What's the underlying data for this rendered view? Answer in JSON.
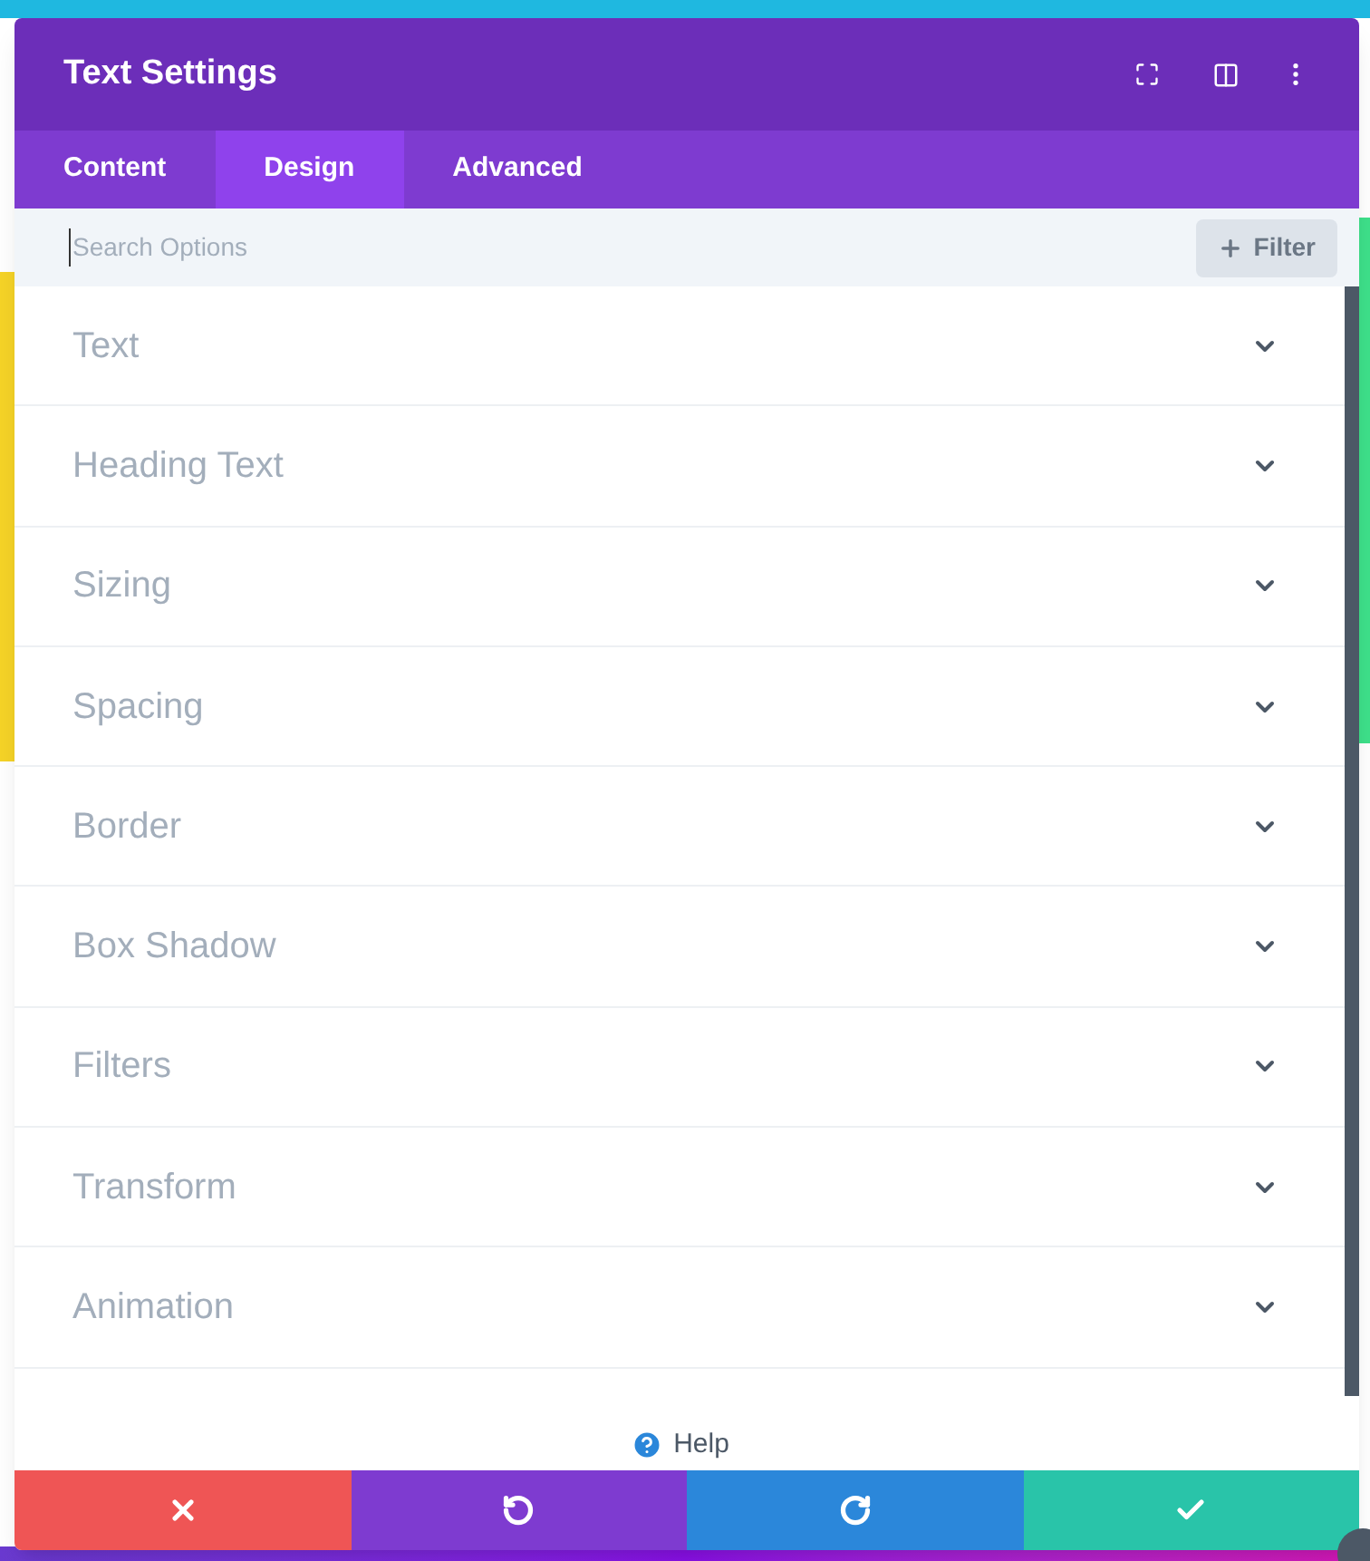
{
  "modal": {
    "title": "Text Settings"
  },
  "tabs": [
    {
      "label": "Content",
      "selected": false
    },
    {
      "label": "Design",
      "selected": true
    },
    {
      "label": "Advanced",
      "selected": false
    }
  ],
  "search": {
    "placeholder": "Search Options",
    "filter_label": "Filter"
  },
  "sections": [
    {
      "label": "Text",
      "expanded": false
    },
    {
      "label": "Heading Text",
      "expanded": false
    },
    {
      "label": "Sizing",
      "expanded": false
    },
    {
      "label": "Spacing",
      "expanded": false
    },
    {
      "label": "Border",
      "expanded": false
    },
    {
      "label": "Box Shadow",
      "expanded": false
    },
    {
      "label": "Filters",
      "expanded": false
    },
    {
      "label": "Transform",
      "expanded": false
    },
    {
      "label": "Animation",
      "expanded": false
    }
  ],
  "help": "Help",
  "footer_buttons": [
    {
      "kind": "discard"
    },
    {
      "kind": "undo"
    },
    {
      "kind": "redo"
    },
    {
      "kind": "save"
    }
  ]
}
